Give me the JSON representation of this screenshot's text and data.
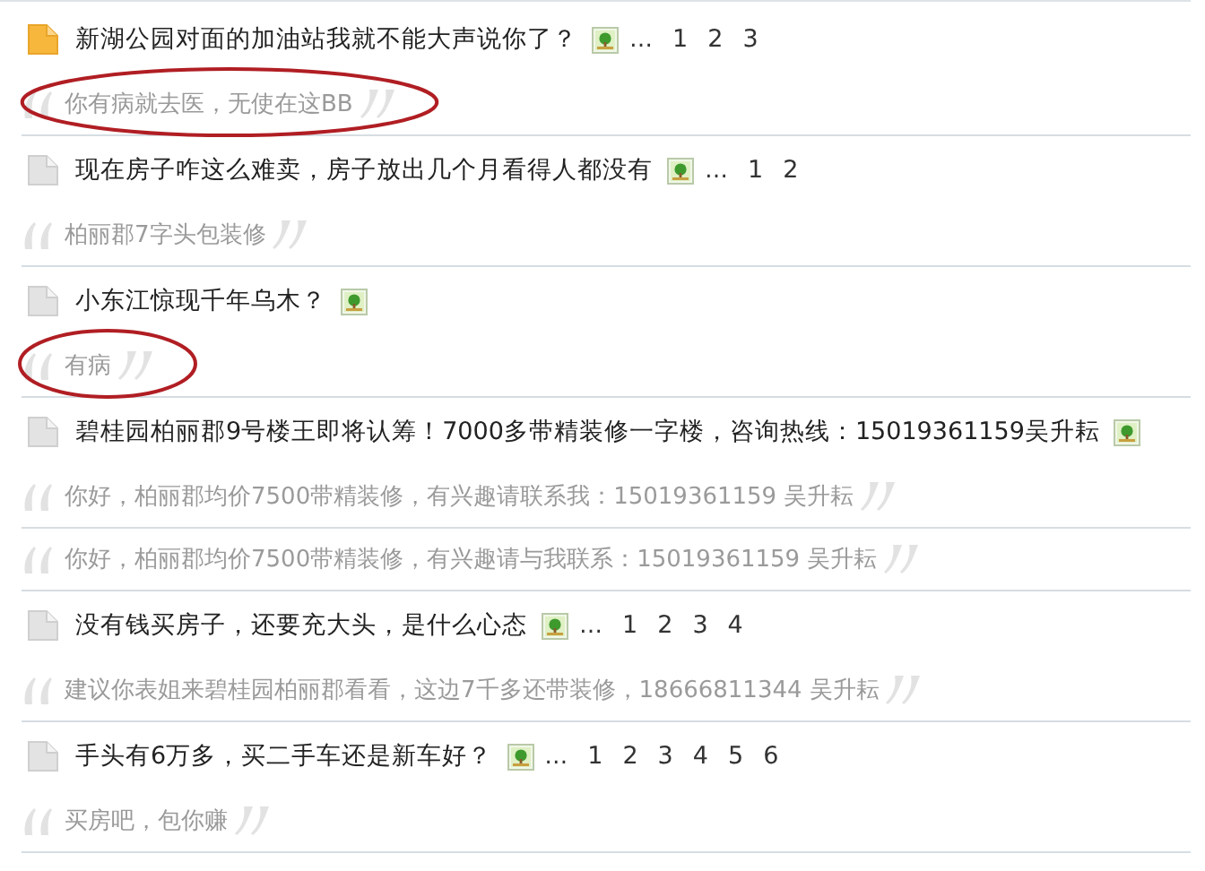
{
  "threads": [
    {
      "title": "新湖公园对面的加油站我就不能大声说你了？",
      "hot": true,
      "has_image": true,
      "more": "…",
      "pages": [
        "1",
        "2",
        "3"
      ],
      "replies": [
        {
          "text": "你有病就去医，无使在这BB",
          "circled": true
        }
      ]
    },
    {
      "title": "现在房子咋这么难卖，房子放出几个月看得人都没有",
      "hot": false,
      "has_image": true,
      "more": "…",
      "pages": [
        "1",
        "2"
      ],
      "replies": [
        {
          "text": "柏丽郡7字头包装修",
          "circled": false
        }
      ]
    },
    {
      "title": "小东江惊现千年乌木？",
      "hot": false,
      "has_image": true,
      "replies": [
        {
          "text": "有病",
          "circled": true
        }
      ]
    },
    {
      "title": "碧桂园柏丽郡9号楼王即将认筹！7000多带精装修一字楼，咨询热线：15019361159吴升耘",
      "hot": false,
      "has_image": true,
      "replies": [
        {
          "text": "你好，柏丽郡均价7500带精装修，有兴趣请联系我：15019361159 吴升耘",
          "circled": false
        },
        {
          "text": "你好，柏丽郡均价7500带精装修，有兴趣请与我联系：15019361159 吴升耘",
          "circled": false
        }
      ]
    },
    {
      "title": "没有钱买房子，还要充大头，是什么心态",
      "hot": false,
      "has_image": true,
      "more": "…",
      "pages": [
        "1",
        "2",
        "3",
        "4"
      ],
      "replies": [
        {
          "text": "建议你表姐来碧桂园柏丽郡看看，这边7千多还带装修，18666811344 吴升耘",
          "circled": false
        }
      ]
    },
    {
      "title": "手头有6万多，买二手车还是新车好？",
      "hot": false,
      "has_image": true,
      "more": "…",
      "pages": [
        "1",
        "2",
        "3",
        "4",
        "5",
        "6"
      ],
      "replies": [
        {
          "text": "买房吧，包你赚",
          "circled": false
        }
      ]
    }
  ]
}
